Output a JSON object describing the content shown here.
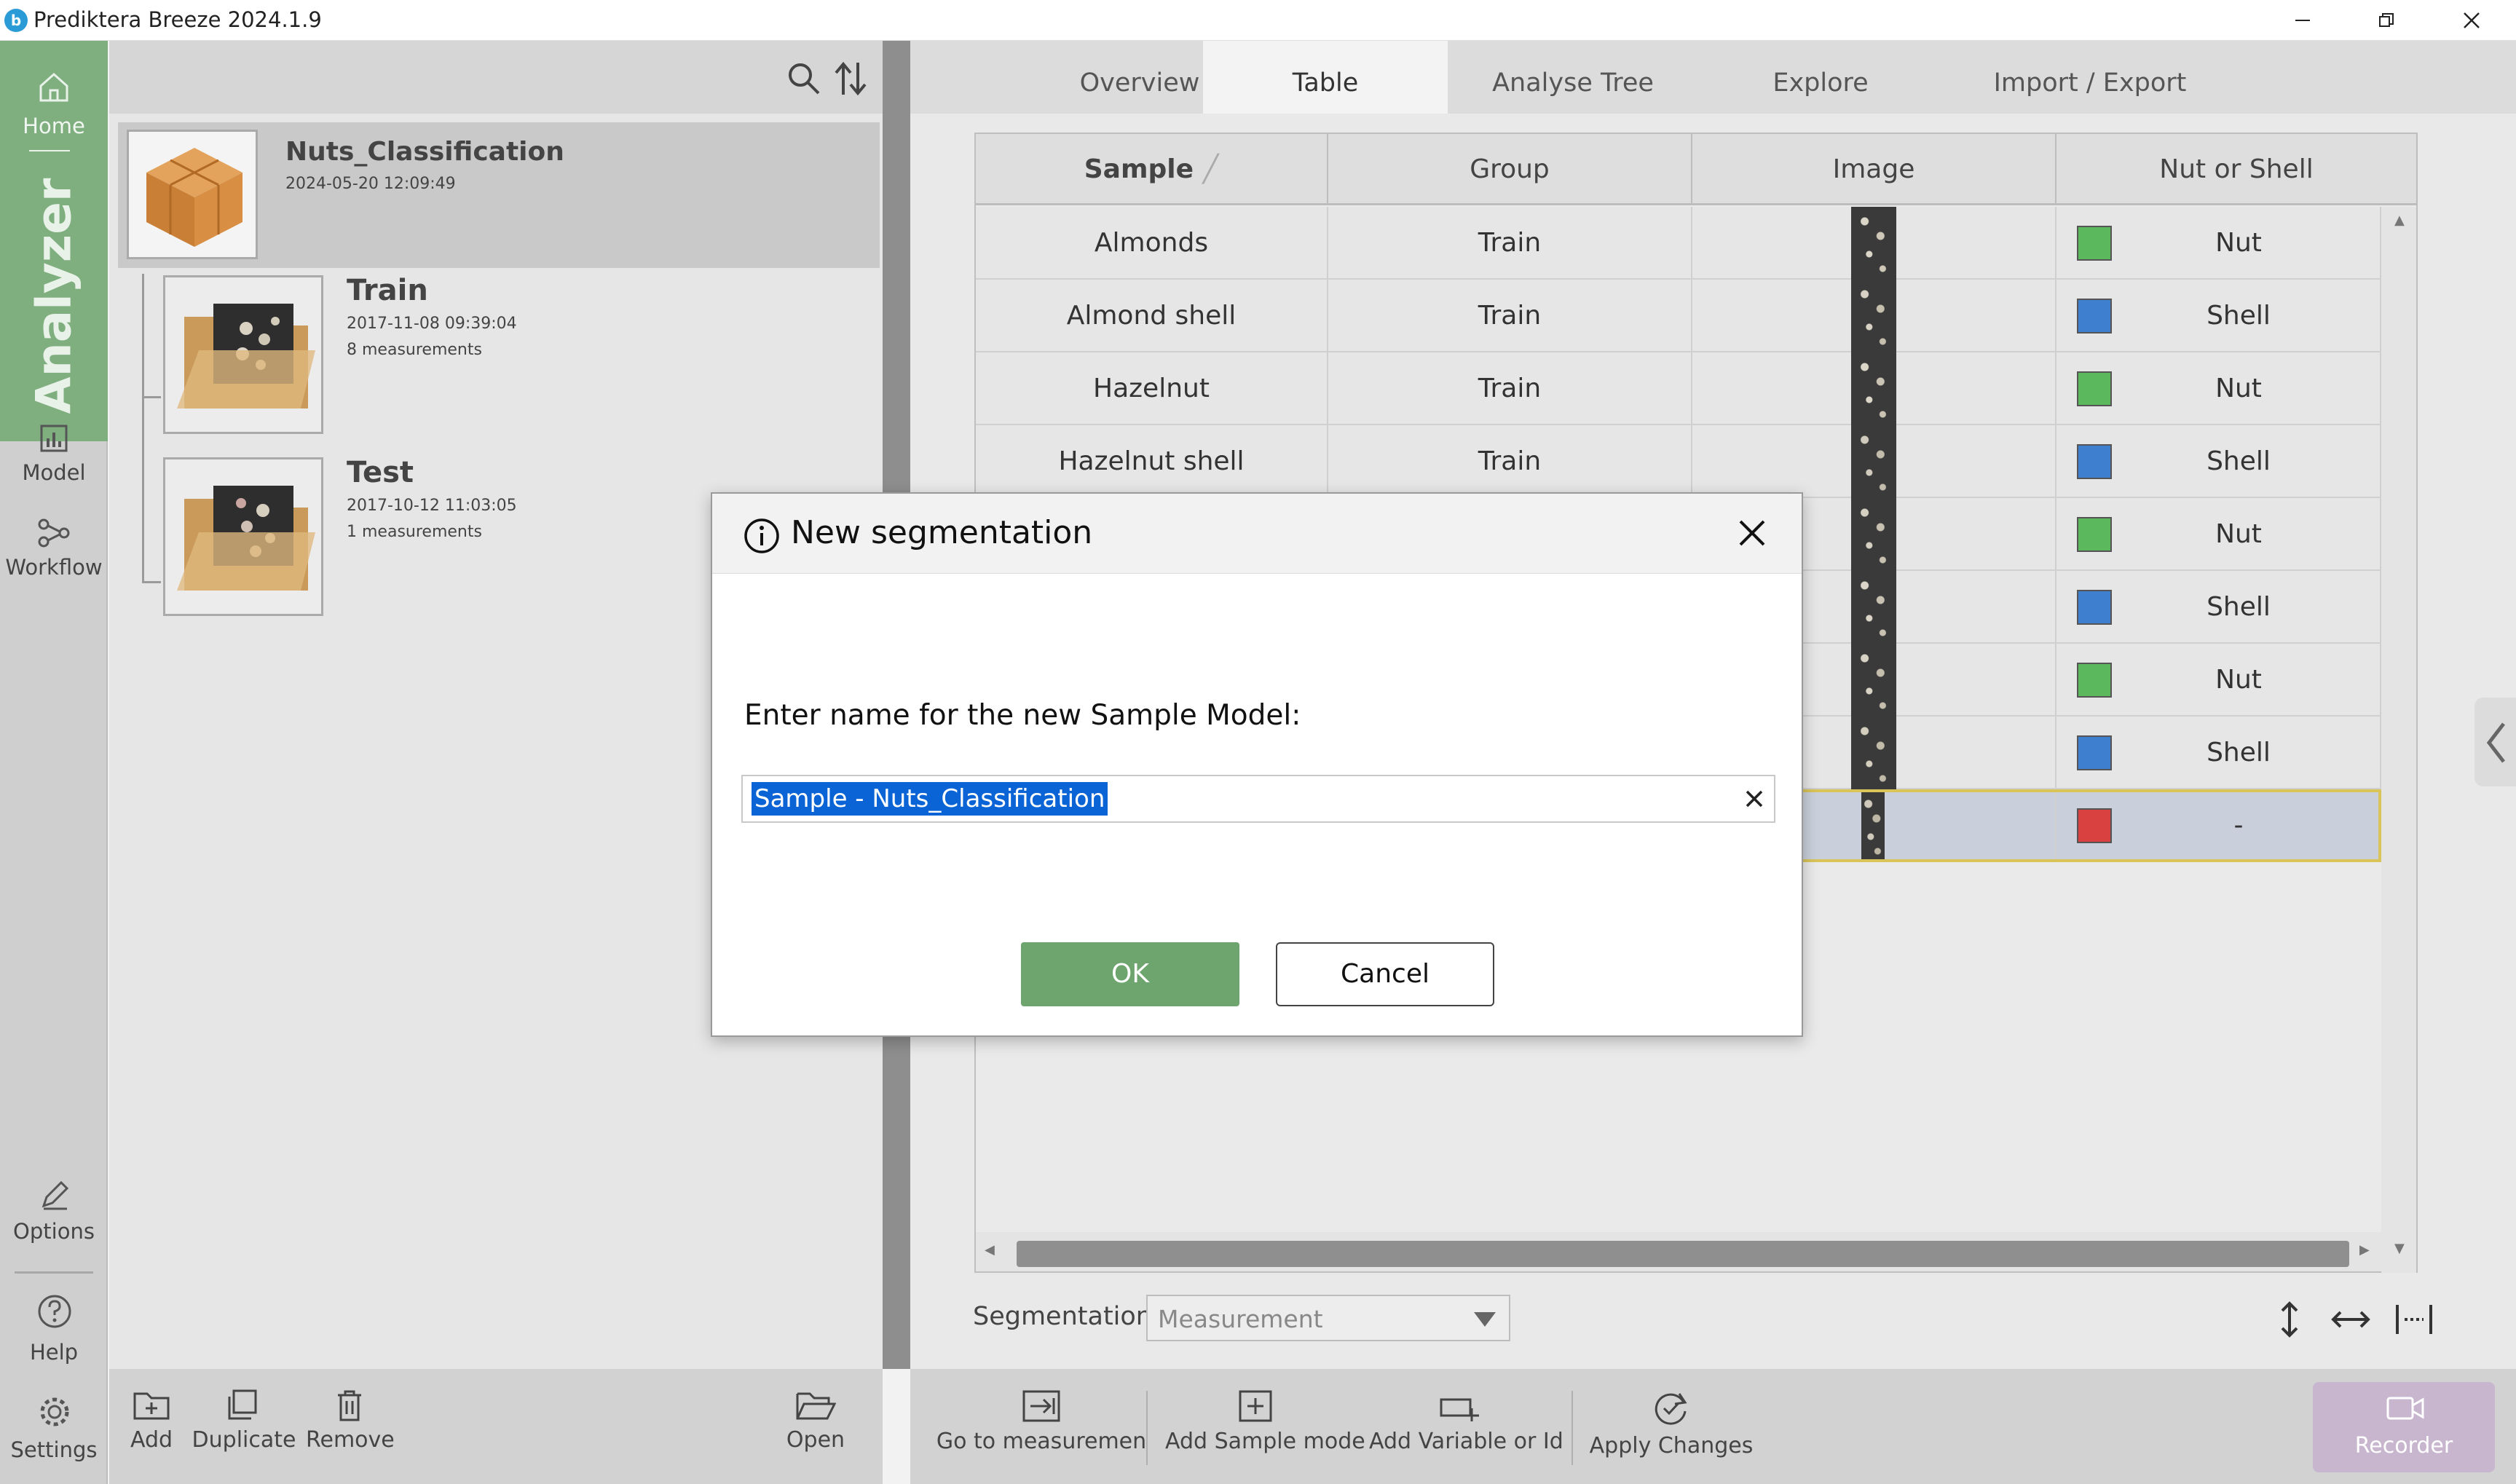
{
  "app": {
    "title": "Prediktera Breeze 2024.1.9",
    "icon_letter": "b"
  },
  "window_controls": {
    "minimize": "minimize-icon",
    "restore": "restore-icon",
    "close": "close-icon"
  },
  "leftnav": {
    "home": "Home",
    "analyzer": "Analyzer",
    "model": "Model",
    "workflow": "Workflow",
    "options": "Options",
    "help": "Help",
    "settings": "Settings"
  },
  "project": {
    "name": "Nuts_Classification",
    "date": "2024-05-20 12:09:49",
    "groups": [
      {
        "name": "Train",
        "date": "2017-11-08 09:39:04",
        "measurements": "8 measurements"
      },
      {
        "name": "Test",
        "date": "2017-10-12 11:03:05",
        "measurements": "1 measurements"
      }
    ]
  },
  "tabs": [
    "Overview",
    "Table",
    "Analyse Tree",
    "Explore",
    "Import / Export"
  ],
  "active_tab": "Table",
  "table": {
    "columns": [
      "Sample",
      "Group",
      "Image",
      "Nut or Shell"
    ],
    "rows": [
      {
        "sample": "Almonds",
        "group": "Train",
        "class": "Nut",
        "color": "#5cb85c"
      },
      {
        "sample": "Almond shell",
        "group": "Train",
        "class": "Shell",
        "color": "#3f7fd0"
      },
      {
        "sample": "Hazelnut",
        "group": "Train",
        "class": "Nut",
        "color": "#5cb85c"
      },
      {
        "sample": "Hazelnut shell",
        "group": "Train",
        "class": "Shell",
        "color": "#3f7fd0"
      },
      {
        "sample": "",
        "group": "",
        "class": "Nut",
        "color": "#5cb85c"
      },
      {
        "sample": "",
        "group": "",
        "class": "Shell",
        "color": "#3f7fd0"
      },
      {
        "sample": "",
        "group": "",
        "class": "Nut",
        "color": "#5cb85c"
      },
      {
        "sample": "",
        "group": "",
        "class": "Shell",
        "color": "#3f7fd0"
      },
      {
        "sample": "",
        "group": "",
        "class": "-",
        "color": "#d94040"
      }
    ]
  },
  "segmentation": {
    "label": "Segmentation",
    "value": "Measurement"
  },
  "bottom_left": [
    "Add",
    "Duplicate",
    "Remove",
    "Open"
  ],
  "bottom_right": [
    "Go to measuremen",
    "Add Sample mode",
    "Add Variable or Id",
    "Apply Changes"
  ],
  "recorder": "Recorder",
  "dialog": {
    "title": "New segmentation",
    "prompt": "Enter name for the new Sample Model:",
    "input_value": "Sample - Nuts_Classification",
    "ok": "OK",
    "cancel": "Cancel"
  }
}
